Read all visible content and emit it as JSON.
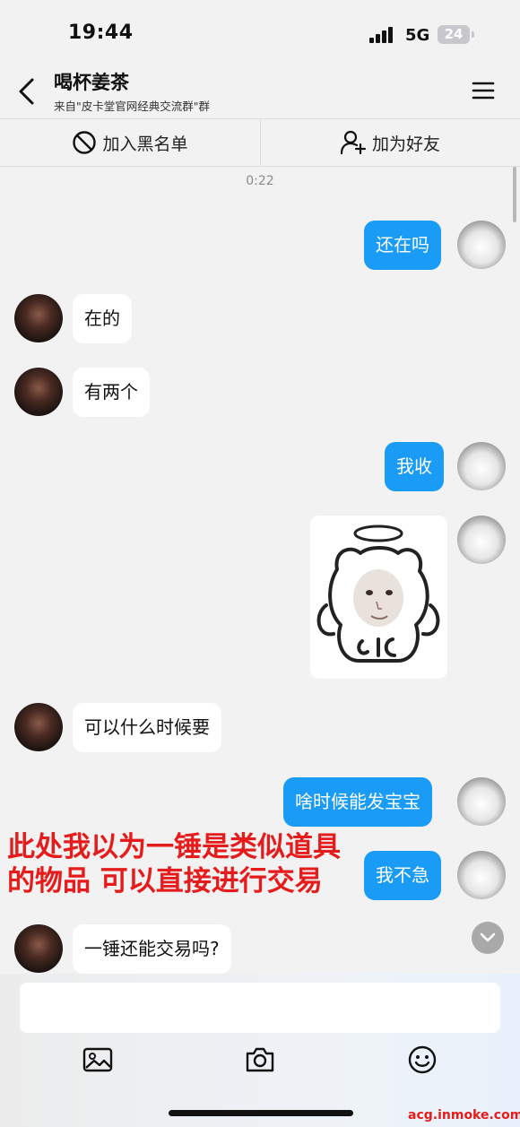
{
  "status_bar": {
    "time": "19:44",
    "network": "5G",
    "battery": "24"
  },
  "header": {
    "title": "喝杯姜茶",
    "subtitle": "来自\"皮卡堂官网经典交流群\"群"
  },
  "actions": {
    "blacklist_label": "加入黑名单",
    "add_friend_label": "加为好友"
  },
  "chat": {
    "timestamp": "0:22",
    "messages": [
      {
        "from": "me",
        "text": "还在吗"
      },
      {
        "from": "other",
        "text": "在的"
      },
      {
        "from": "other",
        "text": "有两个"
      },
      {
        "from": "me",
        "text": "我收"
      },
      {
        "from": "me",
        "type": "sticker"
      },
      {
        "from": "other",
        "text": "可以什么时候要"
      },
      {
        "from": "me",
        "text": "啥时候能发宝宝"
      },
      {
        "from": "me",
        "text": "我不急"
      },
      {
        "from": "other",
        "text": "一锤还能交易吗?"
      }
    ]
  },
  "annotation": {
    "line1": "此处我以为一锤是类似道具",
    "line2": "的物品 可以直接进行交易"
  },
  "toolbar": {
    "icons": [
      "image-icon",
      "camera-icon",
      "emoji-icon"
    ]
  },
  "watermark": "acg.inmoke.com",
  "colors": {
    "outgoing_bubble": "#1a9bf5",
    "incoming_bubble": "#ffffff",
    "background": "#f2f2f2",
    "annotation": "#e61b1b"
  }
}
